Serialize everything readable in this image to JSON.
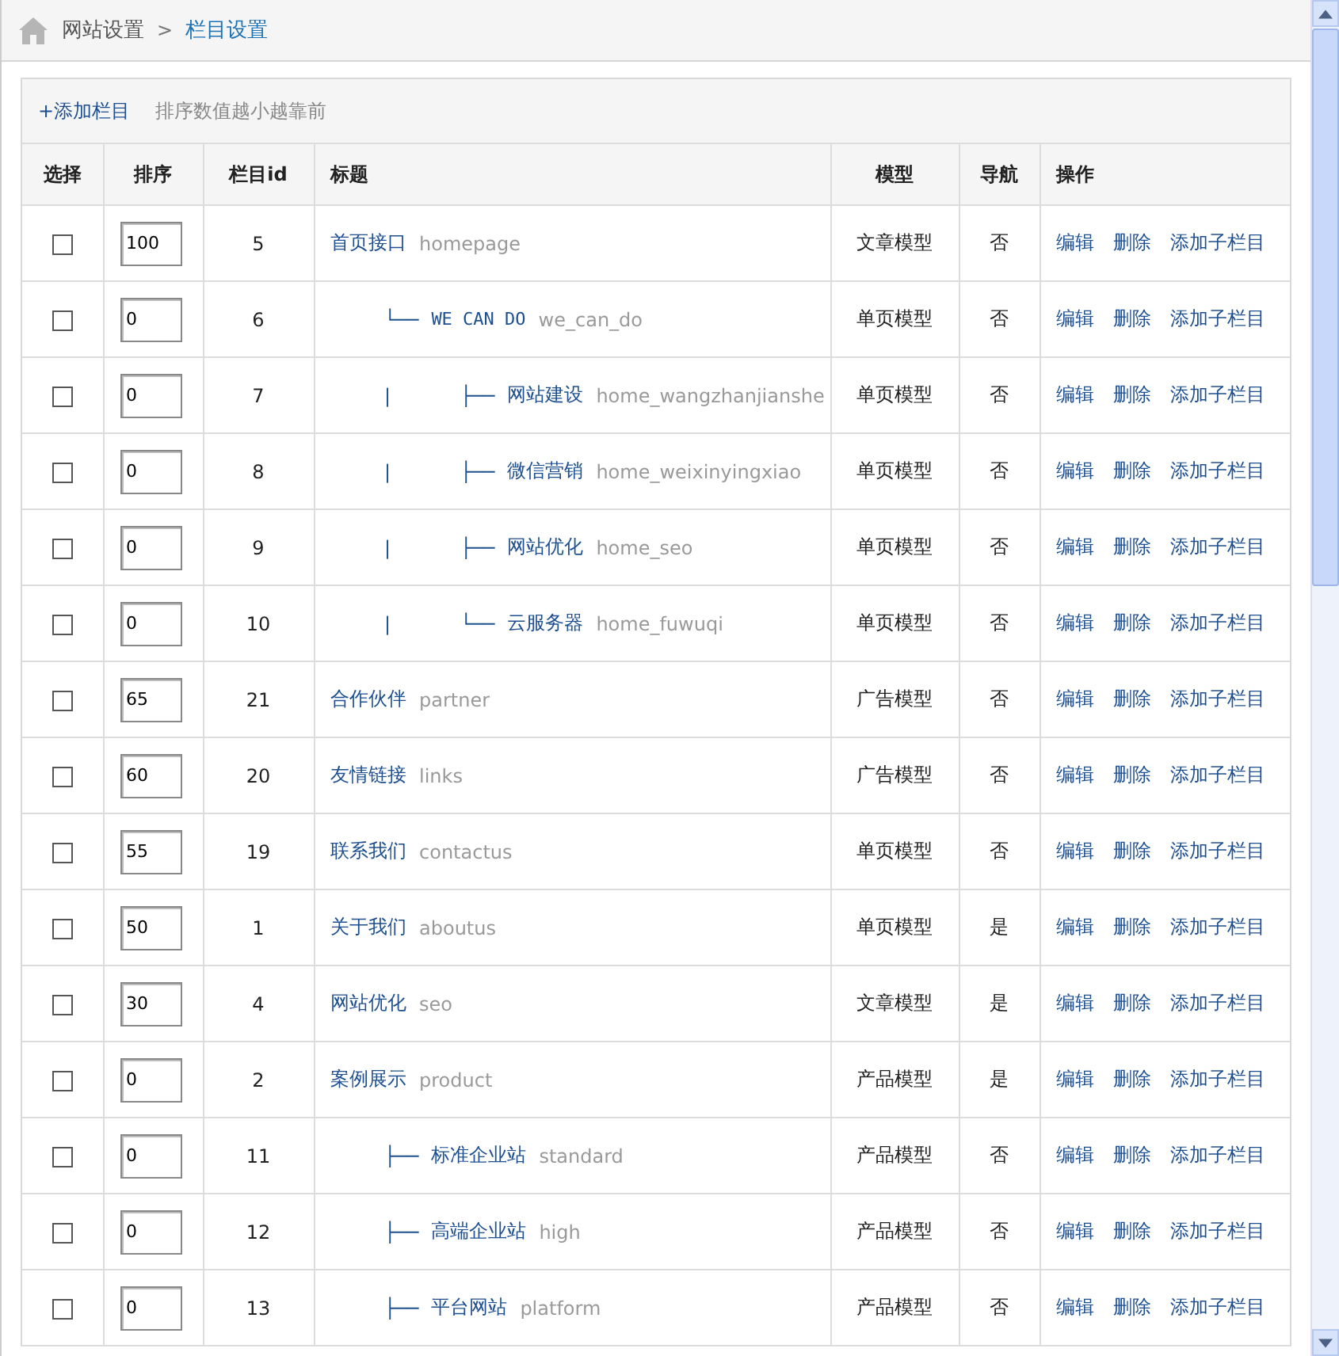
{
  "breadcrumb": {
    "items": [
      {
        "label": "网站设置",
        "selected": false
      },
      {
        "label": "栏目设置",
        "selected": true
      }
    ],
    "separator": ">"
  },
  "toolbar": {
    "add_link": "+添加栏目",
    "hint": "排序数值越小越靠前"
  },
  "table": {
    "columns": [
      "选择",
      "排序",
      "栏目id",
      "标题",
      "模型",
      "导航",
      "操作"
    ],
    "rows": [
      {
        "checked": false,
        "order": "100",
        "id": "5",
        "title": "首页接口",
        "alias": "homepage",
        "model": "文章模型",
        "nav": "否",
        "actions": [
          "编辑",
          "删除",
          "添加子栏目"
        ],
        "children": [
          {
            "branch": "└──",
            "checked": false,
            "order": "0",
            "id": "6",
            "title": "WE CAN DO",
            "alias": "we_can_do",
            "model": "单页模型",
            "nav": "否",
            "actions": [
              "编辑",
              "删除",
              "添加子栏目"
            ],
            "children": [
              {
                "guide": "|",
                "branch": "├──",
                "checked": false,
                "order": "0",
                "id": "7",
                "title": "网站建设",
                "alias": "home_wangzhanjianshe",
                "model": "单页模型",
                "nav": "否",
                "actions": [
                  "编辑",
                  "删除",
                  "添加子栏目"
                ]
              },
              {
                "guide": "|",
                "branch": "├──",
                "checked": false,
                "order": "0",
                "id": "8",
                "title": "微信营销",
                "alias": "home_weixinyingxiao",
                "model": "单页模型",
                "nav": "否",
                "actions": [
                  "编辑",
                  "删除",
                  "添加子栏目"
                ]
              },
              {
                "guide": "|",
                "branch": "├──",
                "checked": false,
                "order": "0",
                "id": "9",
                "title": "网站优化",
                "alias": "home_seo",
                "model": "单页模型",
                "nav": "否",
                "actions": [
                  "编辑",
                  "删除",
                  "添加子栏目"
                ]
              },
              {
                "guide": "|",
                "branch": "└──",
                "checked": false,
                "order": "0",
                "id": "10",
                "title": "云服务器",
                "alias": "home_fuwuqi",
                "model": "单页模型",
                "nav": "否",
                "actions": [
                  "编辑",
                  "删除",
                  "添加子栏目"
                ]
              }
            ]
          }
        ]
      },
      {
        "checked": false,
        "order": "65",
        "id": "21",
        "title": "合作伙伴",
        "alias": "partner",
        "model": "广告模型",
        "nav": "否",
        "actions": [
          "编辑",
          "删除",
          "添加子栏目"
        ]
      },
      {
        "checked": false,
        "order": "60",
        "id": "20",
        "title": "友情链接",
        "alias": "links",
        "model": "广告模型",
        "nav": "否",
        "actions": [
          "编辑",
          "删除",
          "添加子栏目"
        ]
      },
      {
        "checked": false,
        "order": "55",
        "id": "19",
        "title": "联系我们",
        "alias": "contactus",
        "model": "单页模型",
        "nav": "否",
        "actions": [
          "编辑",
          "删除",
          "添加子栏目"
        ]
      },
      {
        "checked": false,
        "order": "50",
        "id": "1",
        "title": "关于我们",
        "alias": "aboutus",
        "model": "单页模型",
        "nav": "是",
        "actions": [
          "编辑",
          "删除",
          "添加子栏目"
        ]
      },
      {
        "checked": false,
        "order": "30",
        "id": "4",
        "title": "网站优化",
        "alias": "seo",
        "model": "文章模型",
        "nav": "是",
        "actions": [
          "编辑",
          "删除",
          "添加子栏目"
        ]
      },
      {
        "checked": false,
        "order": "0",
        "id": "2",
        "title": "案例展示",
        "alias": "product",
        "model": "产品模型",
        "nav": "是",
        "actions": [
          "编辑",
          "删除",
          "添加子栏目"
        ],
        "children": [
          {
            "branch": "├──",
            "checked": false,
            "order": "0",
            "id": "11",
            "title": "标准企业站",
            "alias": "standard",
            "model": "产品模型",
            "nav": "否",
            "actions": [
              "编辑",
              "删除",
              "添加子栏目"
            ]
          },
          {
            "branch": "├──",
            "checked": false,
            "order": "0",
            "id": "12",
            "title": "高端企业站",
            "alias": "high",
            "model": "产品模型",
            "nav": "否",
            "actions": [
              "编辑",
              "删除",
              "添加子栏目"
            ]
          },
          {
            "branch": "├──",
            "checked": false,
            "order": "0",
            "id": "13",
            "title": "平台网站",
            "alias": "platform",
            "model": "产品模型",
            "nav": "否",
            "actions": [
              "编辑",
              "删除",
              "添加子栏目"
            ]
          }
        ]
      }
    ]
  }
}
